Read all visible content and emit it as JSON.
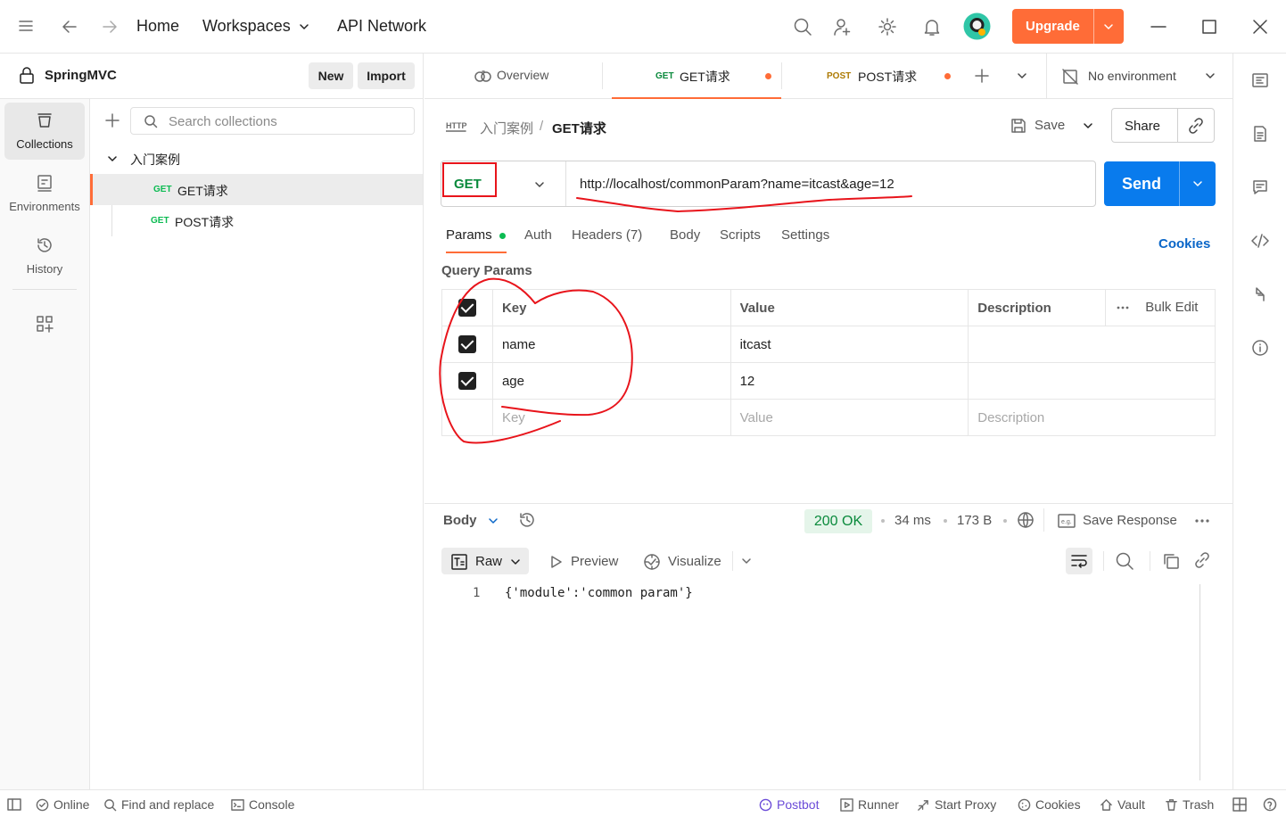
{
  "topbar": {
    "nav": {
      "home": "Home",
      "workspaces": "Workspaces",
      "api_network": "API Network"
    },
    "upgrade_label": "Upgrade"
  },
  "workspace": {
    "name": "SpringMVC",
    "new_label": "New",
    "import_label": "Import"
  },
  "rail": {
    "items": [
      {
        "label": "Collections",
        "icon": "collections-icon"
      },
      {
        "label": "Environments",
        "icon": "environments-icon"
      },
      {
        "label": "History",
        "icon": "history-icon"
      }
    ]
  },
  "sidebar": {
    "search_placeholder": "Search collections",
    "folder": "入门案例",
    "requests": [
      {
        "method": "GET",
        "name": "GET请求"
      },
      {
        "method": "GET",
        "name": "POST请求"
      }
    ]
  },
  "tabs": {
    "overview": "Overview",
    "items": [
      {
        "method": "GET",
        "name": "GET请求"
      },
      {
        "method": "POST",
        "name": "POST请求"
      }
    ],
    "environment": "No environment"
  },
  "request": {
    "breadcrumb_parent": "入门案例",
    "breadcrumb_sep": "/",
    "title": "GET请求",
    "save_label": "Save",
    "share_label": "Share",
    "method": "GET",
    "url": "http://localhost/commonParam?name=itcast&age=12",
    "send_label": "Send",
    "subtabs": [
      "Params",
      "Auth",
      "Headers (7)",
      "Body",
      "Scripts",
      "Settings"
    ],
    "cookies_label": "Cookies",
    "query_params_title": "Query Params",
    "table": {
      "headers": {
        "key": "Key",
        "value": "Value",
        "description": "Description",
        "bulk_edit": "Bulk Edit"
      },
      "rows": [
        {
          "key": "name",
          "value": "itcast"
        },
        {
          "key": "age",
          "value": "12"
        }
      ],
      "placeholders": {
        "key": "Key",
        "value": "Value",
        "description": "Description"
      }
    }
  },
  "response": {
    "body_label": "Body",
    "status": "200 OK",
    "time": "34 ms",
    "size": "173 B",
    "save_response_label": "Save Response",
    "format": "Raw",
    "preview_label": "Preview",
    "visualize_label": "Visualize",
    "line_number": "1",
    "body": "{'module':'common param'}"
  },
  "statusbar": {
    "online": "Online",
    "find_replace": "Find and replace",
    "console": "Console",
    "postbot": "Postbot",
    "runner": "Runner",
    "start_proxy": "Start Proxy",
    "cookies": "Cookies",
    "vault": "Vault",
    "trash": "Trash"
  },
  "colors": {
    "accent": "#ff6c37",
    "send": "#097bed",
    "get": "#0cbb52",
    "post": "#ad7a03",
    "annotation": "#e8141b"
  }
}
